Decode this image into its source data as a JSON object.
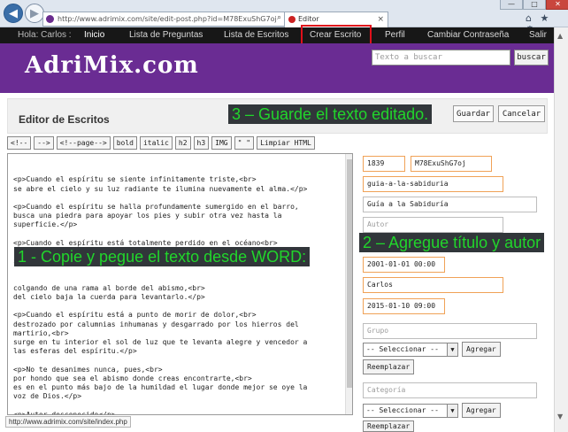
{
  "browser": {
    "address": "http://www.adrimix.com/site/edit-post.php?id=M78ExuShG7oj",
    "address_domain": "adrimix",
    "tab_title": "Editor",
    "address_actions": "⌕ ▾ ↻",
    "tab_close": "×",
    "window_controls": {
      "minimize": "—",
      "maximize": "□",
      "close": "✕"
    },
    "tool_icons": "⌂ ★ ⚙",
    "status_url": "http://www.adrimix.com/site/index.php"
  },
  "nav": {
    "greeting": "Hola: Carlos :",
    "items": [
      "Inicio",
      "Lista de Preguntas",
      "Lista de Escritos",
      "Crear Escrito",
      "Perfil",
      "Cambiar Contraseña",
      "Salir"
    ]
  },
  "header": {
    "logo": "AdriMix.com",
    "search_placeholder": "Texto a buscar",
    "search_button": "buscar"
  },
  "editor": {
    "title": "Editor de Escritos",
    "save_label": "Guardar",
    "cancel_label": "Cancelar",
    "toolbar": [
      "<!--",
      "-->",
      "<!--page-->",
      "bold",
      "italic",
      "h2",
      "h3",
      "IMG",
      "\" \"",
      "Limpiar HTML"
    ],
    "content": "<p>Cuando el espíritu se siente infinitamente triste,<br>\nse abre el cielo y su luz radiante te ilumina nuevamente el alma.</p>\n\n<p>Cuando el espíritu se halla profundamente sumergido en el barro,\nbusca una piedra para apoyar los pies y subir otra vez hasta la\nsuperficie.</p>\n\n<p>Cuando el espíritu está totalmente perdido en el océano<br>\nrevuelto por la inmensidad de las olas,<br>\nse presenta una tabla de salvación donde agarrarse,<br>\n\n\ncolgando de una rama al borde del abismo,<br>\ndel cielo baja la cuerda para levantarlo.</p>\n\n<p>Cuando el espíritu está a punto de morir de dolor,<br>\ndestrozado por calumnias inhumanas y desgarrado por los hierros del\nmartirio,<br>\nsurge en tu interior el sol de luz que te levanta alegre y vencedor a\nlas esferas del espíritu.</p>\n\n<p>No te desanimes nunca, pues,<br>\npor hondo que sea el abismo donde creas encontrarte,<br>\nes en el punto más bajo de la humildad el lugar donde mejor se oye la\nvoz de Dios.</p>\n\n<p>Autor desconocido</p>"
  },
  "form": {
    "id_number": "1839",
    "code": "M78ExuShG7oj",
    "slug": "guia-a-la-sabiduria",
    "title": "Guía a la Sabiduría",
    "author_placeholder": "Autor",
    "date_published": "2001-01-01 00:00",
    "user": "Carlos",
    "date_modified": "2015-01-10 09:00",
    "group_placeholder": "Grupo",
    "select_default": "-- Seleccionar --",
    "add_button": "Agregar",
    "replace_button": "Reemplazar",
    "category_placeholder": "Categoría"
  },
  "annotations": {
    "save": "3 – Guarde el texto editado.",
    "title_author": "2 – Agregue título y autor",
    "copy": "1 - Copie y pegue el texto desde WORD:"
  },
  "colors": {
    "header_purple": "#6a2c93",
    "annotation_green": "#21d62b",
    "highlight_red": "#e0101b",
    "field_orange": "#f0a257"
  }
}
